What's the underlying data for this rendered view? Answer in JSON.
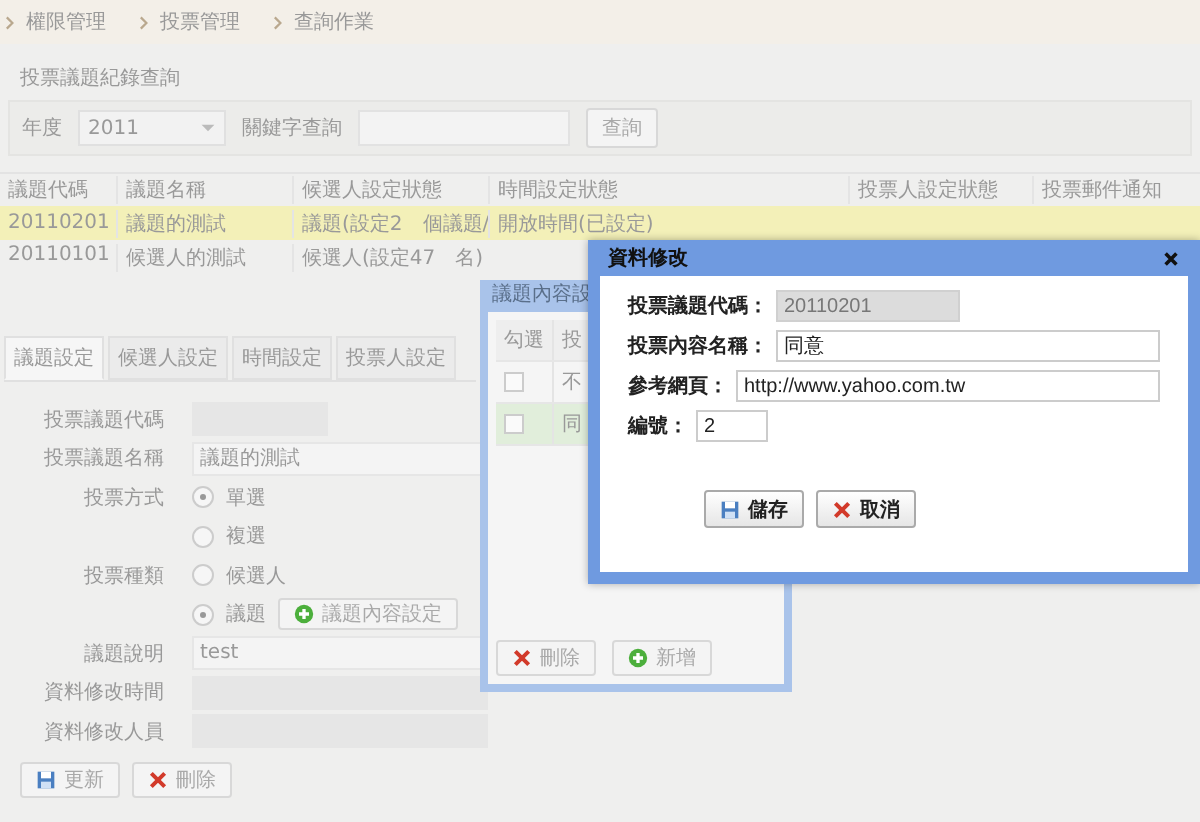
{
  "breadcrumb": [
    {
      "label": "權限管理"
    },
    {
      "label": "投票管理"
    },
    {
      "label": "查詢作業"
    }
  ],
  "search_panel": {
    "title": "投票議題紀錄查詢",
    "year_label": "年度",
    "year_value": "2011",
    "keyword_label": "關鍵字查詢",
    "button": "查詢"
  },
  "table": {
    "columns": [
      "議題代碼",
      "議題名稱",
      "候選人設定狀態",
      "時間設定狀態",
      "投票人設定狀態",
      "投票郵件通知"
    ],
    "rows": [
      {
        "selected": true,
        "cells": [
          "20110201",
          "議題的測試",
          "議題(設定2　個議題/",
          "開放時間(已設定)"
        ]
      },
      {
        "selected": false,
        "cells": [
          "20110101",
          "候選人的測試",
          "候選人(設定47　名)"
        ]
      }
    ]
  },
  "tabs": [
    {
      "label": "議題設定",
      "selected": true
    },
    {
      "label": "候選人設定",
      "selected": false
    },
    {
      "label": "時間設定",
      "selected": false
    },
    {
      "label": "投票人設定",
      "selected": false
    }
  ],
  "form": [
    {
      "kind": "field",
      "label": "投票議題代碼",
      "disabled": true
    },
    {
      "kind": "field",
      "label": "投票議題名稱",
      "value": "議題的測試",
      "disabled": false
    },
    {
      "kind": "radio",
      "label": "投票方式",
      "options": [
        {
          "label": "單選",
          "selected": true
        },
        {
          "label": "複選",
          "selected": false
        }
      ]
    },
    {
      "kind": "radio",
      "label": "投票種類",
      "options": [
        {
          "label": "候選人",
          "selected": false
        },
        {
          "label": "議題",
          "selected": true,
          "button": "議題內容設定"
        }
      ]
    },
    {
      "kind": "field",
      "label": "議題說明",
      "value": "test",
      "disabled": false
    },
    {
      "kind": "field",
      "label": "資料修改時間",
      "disabled": true
    },
    {
      "kind": "field",
      "label": "資料修改人員",
      "disabled": true
    }
  ],
  "form_buttons": [
    {
      "kind": "save",
      "label": "更新"
    },
    {
      "kind": "delete",
      "label": "刪除"
    }
  ],
  "content_dialog": {
    "title": "議題內容設",
    "columns": [
      "勾選",
      "投"
    ],
    "rows": [
      {
        "checked": false,
        "selected": false,
        "text": "不"
      },
      {
        "checked": false,
        "selected": true,
        "text": "同"
      }
    ],
    "buttons": [
      {
        "kind": "delete",
        "label": "刪除"
      },
      {
        "kind": "add",
        "label": "新增"
      }
    ]
  },
  "edit_dialog": {
    "title": "資料修改",
    "fields": [
      {
        "kind": "code",
        "label": "投票議題代碼：",
        "value": "20110201",
        "disabled": true
      },
      {
        "kind": "text",
        "label": "投票內容名稱：",
        "value": "同意",
        "disabled": false
      },
      {
        "kind": "text",
        "label": "參考網頁：",
        "value": "http://www.yahoo.com.tw",
        "disabled": false
      },
      {
        "kind": "number",
        "label": "編號：",
        "value": "2",
        "disabled": false
      }
    ],
    "buttons": [
      {
        "kind": "save",
        "label": "儲存"
      },
      {
        "kind": "cancel",
        "label": "取消"
      }
    ]
  }
}
